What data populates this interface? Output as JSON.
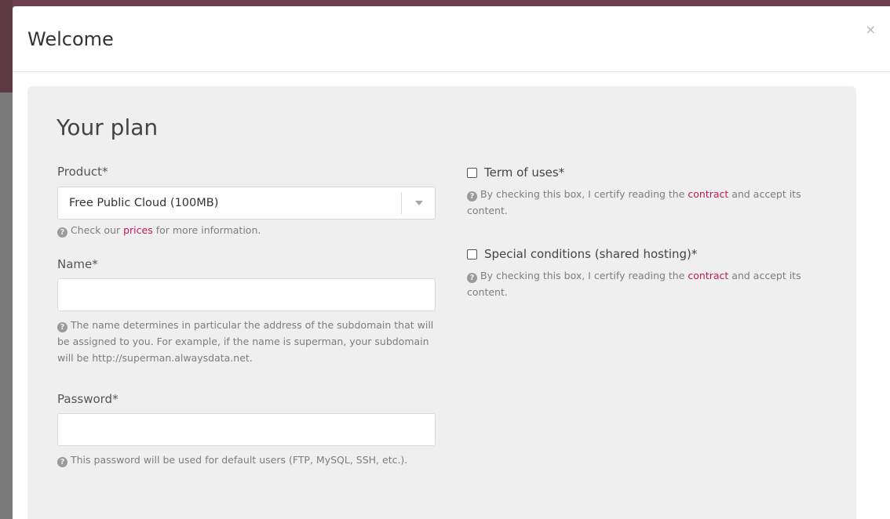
{
  "modal": {
    "title": "Welcome",
    "close_symbol": "×"
  },
  "panel": {
    "title": "Your plan"
  },
  "product": {
    "label": "Product*",
    "selected": "Free Public Cloud (100MB)",
    "help_before": "Check our ",
    "help_link": "prices",
    "help_after": " for more information."
  },
  "name": {
    "label": "Name*",
    "value": "",
    "help": "The name determines in particular the address of the subdomain that will be assigned to you. For example, if the name is superman, your subdomain will be http://superman.alwaysdata.net."
  },
  "password": {
    "label": "Password*",
    "value": "",
    "help": "This password will be used for default users (FTP, MySQL, SSH, etc.)."
  },
  "terms": {
    "label": "Term of uses*",
    "checked": false,
    "help_before": "By checking this box, I certify reading the ",
    "help_link": "contract",
    "help_after": " and accept its content."
  },
  "special": {
    "label": "Special conditions (shared hosting)*",
    "checked": false,
    "help_before": "By checking this box, I certify reading the ",
    "help_link": "contract",
    "help_after": " and accept its content."
  },
  "icons": {
    "help": "question-circle-icon",
    "close": "close-icon",
    "select_arrow": "caret-down-icon"
  },
  "colors": {
    "link": "#c2185b",
    "panel_bg": "#efefef"
  }
}
